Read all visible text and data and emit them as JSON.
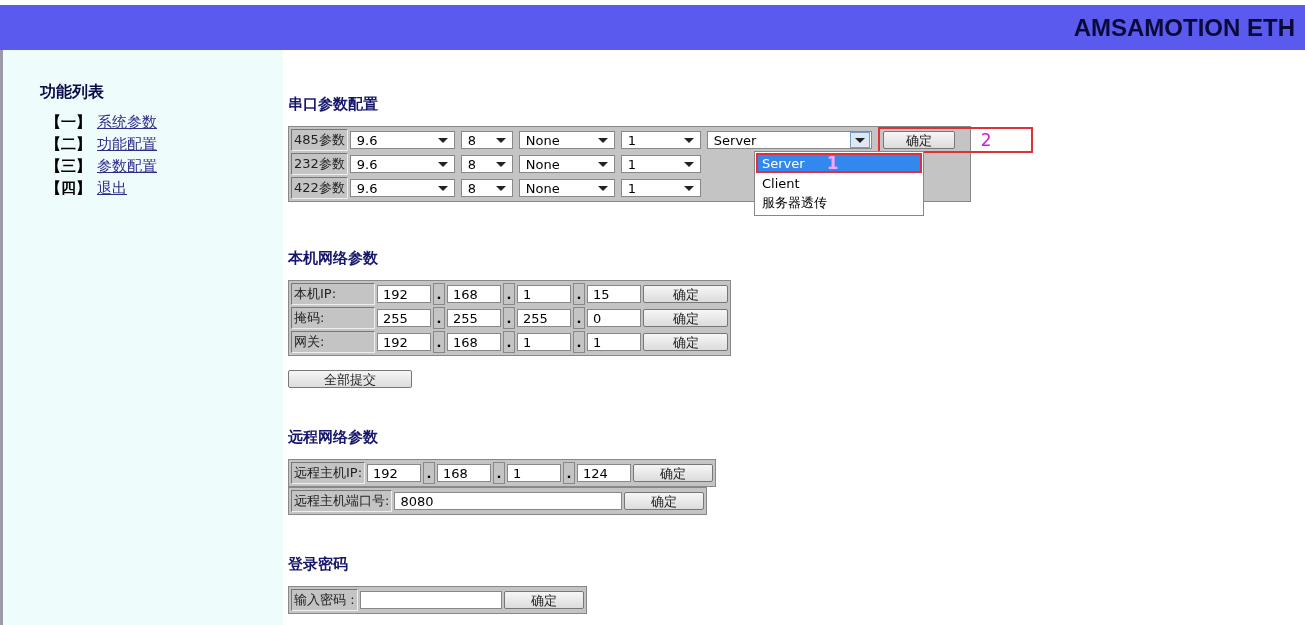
{
  "header": {
    "title": "AMSAMOTION ETH"
  },
  "sidebar": {
    "title": "功能列表",
    "items": [
      {
        "index": "【一】",
        "label": "系统参数"
      },
      {
        "index": "【二】",
        "label": "功能配置"
      },
      {
        "index": "【三】",
        "label": "参数配置"
      },
      {
        "index": "【四】",
        "label": "退出"
      }
    ]
  },
  "serial": {
    "title": "串口参数配置",
    "rows": [
      {
        "label": "485参数",
        "baud": "9.6",
        "data_bits": "8",
        "parity": "None",
        "stop_bits": "1",
        "mode": "Server",
        "confirm": "确定"
      },
      {
        "label": "232参数",
        "baud": "9.6",
        "data_bits": "8",
        "parity": "None",
        "stop_bits": "1"
      },
      {
        "label": "422参数",
        "baud": "9.6",
        "data_bits": "8",
        "parity": "None",
        "stop_bits": "1"
      }
    ],
    "dropdown": {
      "options": [
        {
          "label": "Server",
          "selected": true
        },
        {
          "label": "Client",
          "selected": false
        },
        {
          "label": "服务器透传",
          "selected": false
        }
      ]
    },
    "markers": [
      {
        "label": "1"
      },
      {
        "label": "2"
      }
    ]
  },
  "local": {
    "title": "本机网络参数",
    "rows": [
      {
        "label": "本机IP:",
        "octets": [
          "192",
          "168",
          "1",
          "15"
        ],
        "dots": [
          ".",
          ".",
          "."
        ],
        "confirm": "确定"
      },
      {
        "label": "掩码:",
        "octets": [
          "255",
          "255",
          "255",
          "0"
        ],
        "dots": [
          ".",
          ".",
          "."
        ],
        "confirm": "确定"
      },
      {
        "label": "网关:",
        "octets": [
          "192",
          "168",
          "1",
          "1"
        ],
        "dots": [
          ".",
          ".",
          "."
        ],
        "confirm": "确定"
      }
    ],
    "submit_all": "全部提交"
  },
  "remote": {
    "title": "远程网络参数",
    "rows": [
      {
        "kind": "ip",
        "label": "远程主机IP:",
        "octets": [
          "192",
          "168",
          "1",
          "124"
        ],
        "dots": [
          ".",
          ".",
          "."
        ],
        "confirm": "确定"
      },
      {
        "kind": "port",
        "label": "远程主机端口号:",
        "value": "8080",
        "confirm": "确定"
      }
    ]
  },
  "password": {
    "title": "登录密码",
    "label": "输入密码 :",
    "confirm": "确定"
  }
}
